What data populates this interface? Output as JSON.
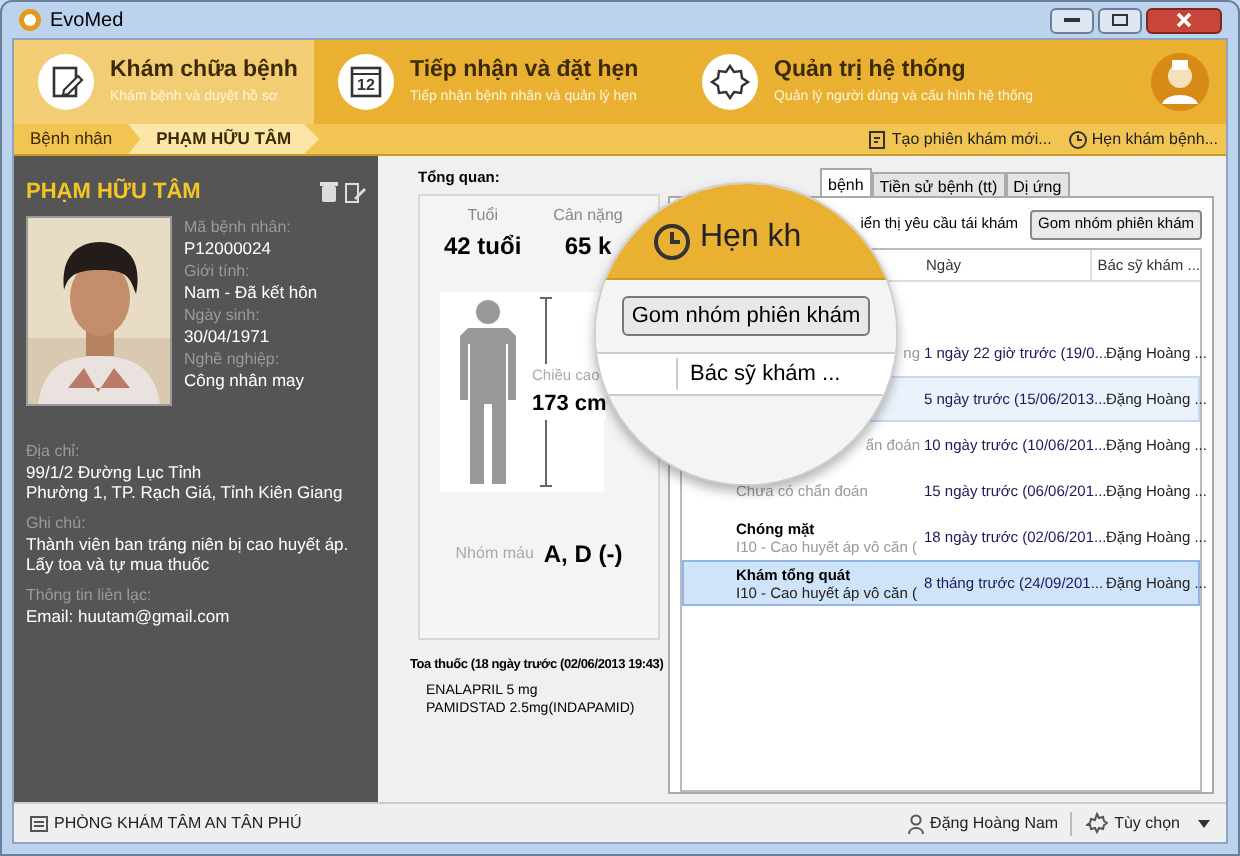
{
  "window": {
    "title": "EvoMed"
  },
  "modules": [
    {
      "title": "Khám chữa bệnh",
      "subtitle": "Khám bệnh và duyệt hồ sơ",
      "kind": "notepad",
      "selected": true
    },
    {
      "title": "Tiếp nhận và đặt hẹn",
      "subtitle": "Tiếp nhận bệnh nhân và quản lý hẹn",
      "kind": "calendar",
      "calendar_day": "12",
      "selected": false
    },
    {
      "title": "Quản trị hệ thống",
      "subtitle": "Quản lý người dùng và cấu hình hệ thống",
      "kind": "gear",
      "selected": false
    }
  ],
  "breadcrumb": [
    {
      "label": "Bệnh nhân",
      "selected": false
    },
    {
      "label": "PHẠM HỮU TÂM",
      "selected": true
    }
  ],
  "actions": [
    {
      "label": "Tạo phiên khám mới...",
      "kind": "new"
    },
    {
      "label": "Hẹn khám bệnh...",
      "kind": "clock"
    }
  ],
  "patient": {
    "name": "PHẠM HỮU TÂM",
    "fields": [
      {
        "label": "Mã bệnh nhân:",
        "value": "P12000024"
      },
      {
        "label": "Giới tính:",
        "value": "Nam - Đã kết hôn"
      },
      {
        "label": "Ngày sinh:",
        "value": "30/04/1971"
      },
      {
        "label": "Nghề nghiệp:",
        "value": "Công nhân may"
      }
    ],
    "details": [
      {
        "label": "Địa chỉ:",
        "lines": [
          "99/1/2 Đường Lục Tỉnh",
          "Phường 1, TP. Rạch Giá, Tỉnh Kiên Giang"
        ]
      },
      {
        "label": "Ghi chú:",
        "lines": [
          "Thành viên ban tráng niên bị cao huyết áp. Lấy toa và tự mua thuốc"
        ]
      },
      {
        "label": "Thông tin liên lạc:",
        "lines": [
          "Email: huutam@gmail.com"
        ]
      }
    ]
  },
  "overview": {
    "heading": "Tổng quan:",
    "age_label": "Tuổi",
    "age": "42 tuổi",
    "weight_label": "Cân nặng",
    "weight": "65 k",
    "height_label": "Chiều cao",
    "height": "173 cm",
    "blood_label": "Nhóm máu",
    "blood": "A, D (-)",
    "prescription_title": "Toa thuốc (18 ngày trước (02/06/2013 19:43)",
    "medicines": [
      "ENALAPRIL 5 mg",
      "PAMIDSTAD 2.5mg(INDAPAMID)"
    ]
  },
  "tabs": [
    {
      "label": "bệnh",
      "selected": true
    },
    {
      "label": "Tiền sử bệnh (tt)",
      "selected": false
    },
    {
      "label": "Dị ứng",
      "selected": false
    }
  ],
  "filter_label": "iển thị yêu cầu tái khám",
  "group_button": "Gom nhóm phiên khám",
  "columns": [
    "Ngày",
    "Bác sỹ khám ..."
  ],
  "visits": [
    {
      "subtitle": "ng",
      "kind": "cut",
      "date": "1 ngày 22 giờ trước (19/0...",
      "doctor": "Đặng Hoàng ...",
      "selected": false,
      "hovered": false
    },
    {
      "date": "5 ngày trước (15/06/2013...",
      "doctor": "Đặng Hoàng ...",
      "selected": false,
      "hovered": true
    },
    {
      "subtitle": "ẩn đoán",
      "kind": "cut",
      "date": "10 ngày trước (10/06/201...",
      "doctor": "Đặng Hoàng ...",
      "selected": false,
      "hovered": false
    },
    {
      "subtitle": "Chưa có chẩn đoán",
      "date": "15 ngày trước (06/06/201...",
      "doctor": "Đặng Hoàng ...",
      "selected": false,
      "hovered": false
    },
    {
      "title": "Chóng mặt",
      "subtitle": "I10 - Cao huyết áp vô căn (",
      "date": "18 ngày trước (02/06/201...",
      "doctor": "Đặng Hoàng ...",
      "selected": false,
      "hovered": false
    },
    {
      "title": "Khám tổng quát",
      "subtitle": "I10 - Cao huyết áp vô căn (",
      "date": "8 tháng trước (24/09/201...",
      "doctor": "Đặng Hoàng ...",
      "selected": true,
      "hovered": false
    }
  ],
  "magnifier": {
    "header": "Hẹn kh",
    "button": "Gom nhóm phiên khám",
    "column": "Bác sỹ khám ..."
  },
  "status_bar": {
    "clinic": "PHÒNG KHÁM TÂM AN TÂN PHÚ",
    "user": "Đặng Hoàng Nam",
    "options": "Tùy chọn"
  }
}
